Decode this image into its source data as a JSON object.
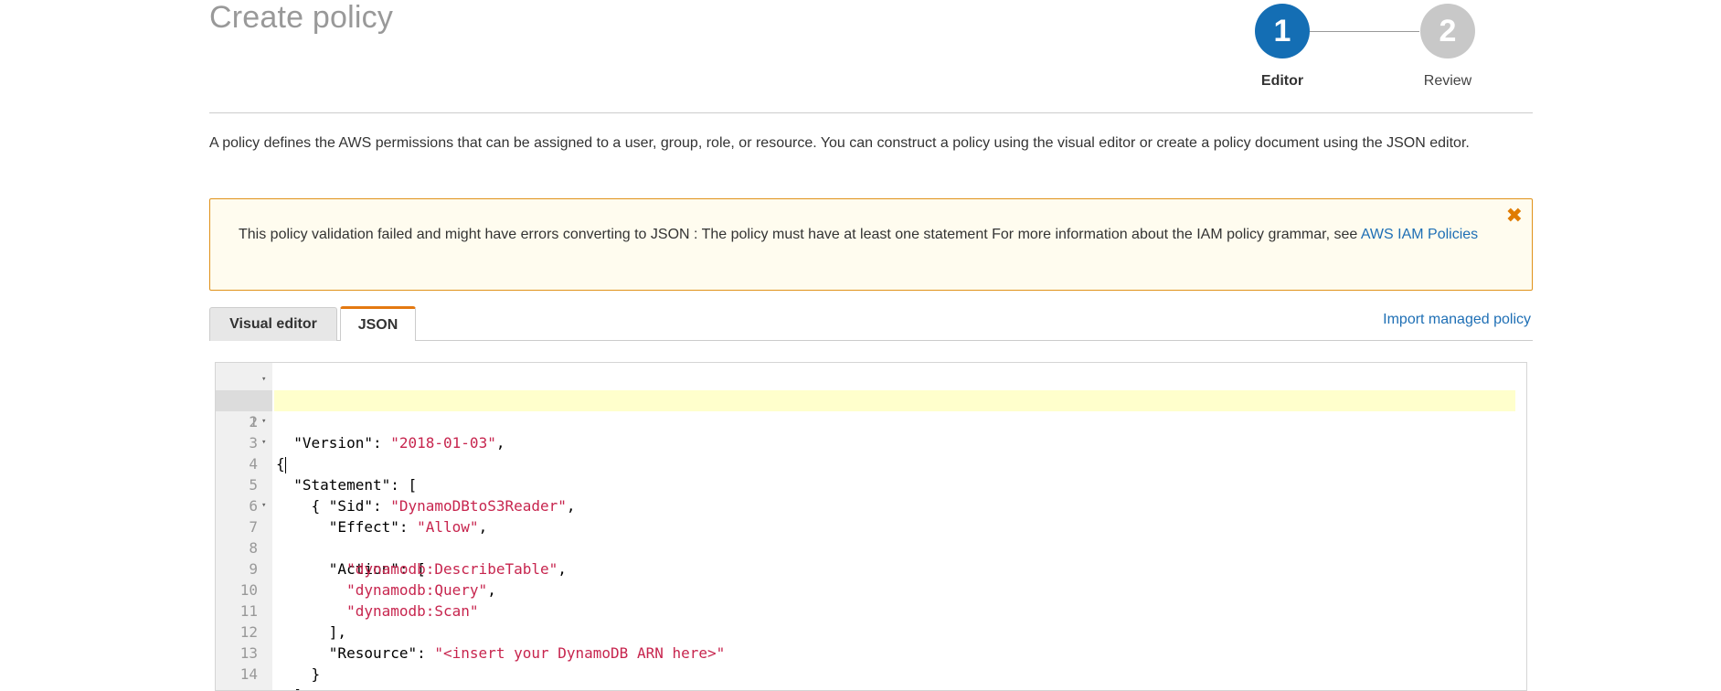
{
  "page": {
    "title": "Create policy"
  },
  "stepper": {
    "steps": [
      {
        "number": "1",
        "label": "Editor",
        "state": "active"
      },
      {
        "number": "2",
        "label": "Review",
        "state": "inactive"
      }
    ]
  },
  "description": "A policy defines the AWS permissions that can be assigned to a user, group, role, or resource. You can construct a policy using the visual editor or create a policy document using the JSON editor.",
  "alert": {
    "message": "This policy validation failed and might have errors converting to JSON : The policy must have at least one statement For more information about the IAM policy grammar, see ",
    "link_text": "AWS IAM Policies",
    "close_icon": "close-icon",
    "border_color": "#e0921a",
    "background_color": "#fffcef"
  },
  "tabs": [
    {
      "label": "Visual editor",
      "selected": false
    },
    {
      "label": "JSON",
      "selected": true
    }
  ],
  "import_link": "Import managed policy",
  "editor": {
    "lines": [
      {
        "n": "1",
        "fold": true
      },
      {
        "n": "2",
        "fold": false
      },
      {
        "n": "3",
        "fold": true
      },
      {
        "n": "4",
        "fold": true
      },
      {
        "n": "5",
        "fold": false
      },
      {
        "n": "6",
        "fold": false
      },
      {
        "n": "7",
        "fold": true
      },
      {
        "n": "8",
        "fold": false
      },
      {
        "n": "9",
        "fold": false
      },
      {
        "n": "10",
        "fold": false
      },
      {
        "n": "11",
        "fold": false
      },
      {
        "n": "12",
        "fold": false
      },
      {
        "n": "13",
        "fold": false
      },
      {
        "n": "14",
        "fold": false
      }
    ],
    "code": {
      "version_key": "\"Version\"",
      "version_value": "\"2018-01-03\"",
      "statement_key": "\"Statement\"",
      "sid_key": "\"Sid\"",
      "sid_value": "\"DynamoDBtoS3Reader\"",
      "effect_key": "\"Effect\"",
      "effect_value": "\"Allow\"",
      "action_key": "\"Action\"",
      "action_1": "\"dynamodb:DescribeTable\"",
      "action_2": "\"dynamodb:Query\"",
      "action_3": "\"dynamodb:Scan\"",
      "resource_key": "\"Resource\"",
      "resource_value": "\"<insert your DynamoDB ARN here>\""
    },
    "string_color": "#c7254e",
    "active_line_color": "#ffffcc"
  },
  "colors": {
    "primary_step": "#146eb4",
    "inactive_step": "#c8c8c8",
    "link": "#1e6fb5",
    "json_tab_accent": "#e47911"
  }
}
